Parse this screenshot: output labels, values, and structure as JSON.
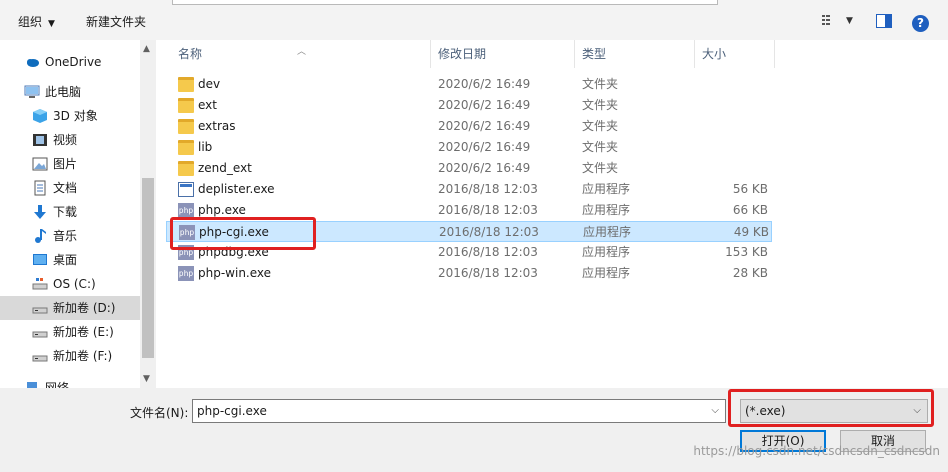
{
  "toolbar": {
    "organize_label": "组织",
    "new_folder_label": "新建文件夹",
    "help_label": "?"
  },
  "sidebar": {
    "items": [
      {
        "label": "OneDrive",
        "icon": "cloud-icon"
      },
      {
        "label": "此电脑",
        "icon": "computer-icon"
      },
      {
        "label": "3D 对象",
        "icon": "cube-icon"
      },
      {
        "label": "视频",
        "icon": "video-icon"
      },
      {
        "label": "图片",
        "icon": "picture-icon"
      },
      {
        "label": "文档",
        "icon": "document-icon"
      },
      {
        "label": "下载",
        "icon": "download-arrow-icon"
      },
      {
        "label": "音乐",
        "icon": "music-note-icon"
      },
      {
        "label": "桌面",
        "icon": "desktop-icon"
      },
      {
        "label": "OS (C:)",
        "icon": "drive-icon"
      },
      {
        "label": "新加卷 (D:)",
        "icon": "drive-icon"
      },
      {
        "label": "新加卷 (E:)",
        "icon": "drive-icon"
      },
      {
        "label": "新加卷 (F:)",
        "icon": "drive-icon"
      },
      {
        "label": "网络",
        "icon": "network-icon"
      }
    ]
  },
  "columns": {
    "name": "名称",
    "date": "修改日期",
    "type": "类型",
    "size": "大小"
  },
  "files": [
    {
      "name": "dev",
      "date": "2020/6/2 16:49",
      "type": "文件夹",
      "size": "",
      "icon": "folder-icon"
    },
    {
      "name": "ext",
      "date": "2020/6/2 16:49",
      "type": "文件夹",
      "size": "",
      "icon": "folder-icon"
    },
    {
      "name": "extras",
      "date": "2020/6/2 16:49",
      "type": "文件夹",
      "size": "",
      "icon": "folder-icon"
    },
    {
      "name": "lib",
      "date": "2020/6/2 16:49",
      "type": "文件夹",
      "size": "",
      "icon": "folder-icon"
    },
    {
      "name": "zend_ext",
      "date": "2020/6/2 16:49",
      "type": "文件夹",
      "size": "",
      "icon": "folder-icon"
    },
    {
      "name": "deplister.exe",
      "date": "2016/8/18 12:03",
      "type": "应用程序",
      "size": "56 KB",
      "icon": "exe-icon"
    },
    {
      "name": "php.exe",
      "date": "2016/8/18 12:03",
      "type": "应用程序",
      "size": "66 KB",
      "icon": "php-icon"
    },
    {
      "name": "php-cgi.exe",
      "date": "2016/8/18 12:03",
      "type": "应用程序",
      "size": "49 KB",
      "icon": "php-icon"
    },
    {
      "name": "phpdbg.exe",
      "date": "2016/8/18 12:03",
      "type": "应用程序",
      "size": "153 KB",
      "icon": "php-icon"
    },
    {
      "name": "php-win.exe",
      "date": "2016/8/18 12:03",
      "type": "应用程序",
      "size": "28 KB",
      "icon": "php-icon"
    }
  ],
  "php_icon_text": "php",
  "bottom": {
    "filename_label": "文件名(N):",
    "filename_value": "php-cgi.exe",
    "filter_value": "(*.exe)",
    "open_label": "打开(O)",
    "cancel_label": "取消"
  },
  "watermark": "https://blog.csdn.net/csdncsdn_csdncsdn",
  "colors": {
    "selection": "#cce8ff",
    "highlight_box": "#e02020",
    "accent": "#0078d7"
  }
}
